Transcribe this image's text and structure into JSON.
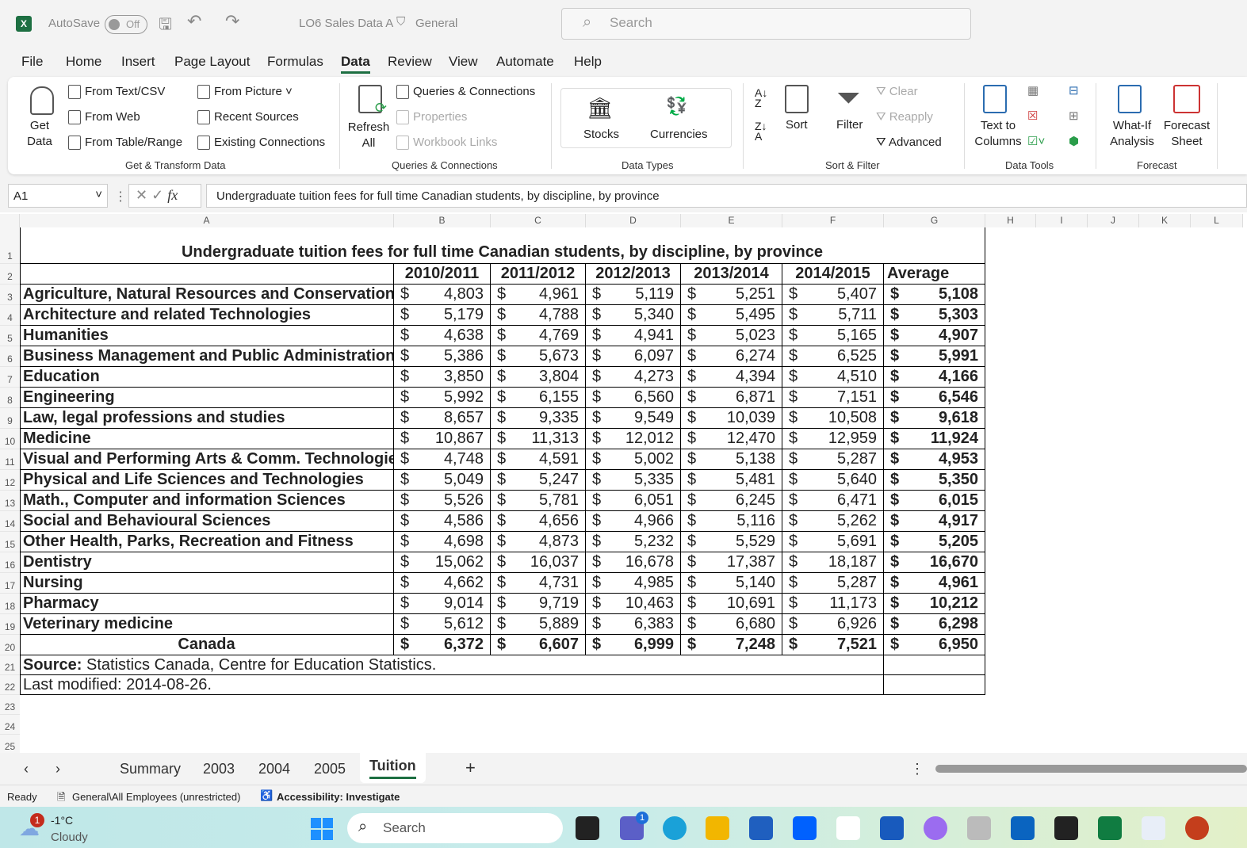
{
  "titlebar": {
    "autosave": "AutoSave",
    "toggle": "Off",
    "filename": "LO6 Sales Data A",
    "label": "General",
    "search": "Search",
    "app_icon": "X"
  },
  "menu": [
    "File",
    "Home",
    "Insert",
    "Page Layout",
    "Formulas",
    "Data",
    "Review",
    "View",
    "Automate",
    "Help"
  ],
  "ribbon": {
    "get_data": "Get Data",
    "get_items": [
      "From Text/CSV",
      "From Web",
      "From Table/Range",
      "From Picture",
      "Recent Sources",
      "Existing Connections"
    ],
    "group1": "Get & Transform Data",
    "refresh": "Refresh All",
    "query_items": [
      "Queries & Connections",
      "Properties",
      "Workbook Links"
    ],
    "group2": "Queries & Connections",
    "stocks": "Stocks",
    "currencies": "Currencies",
    "group3": "Data Types",
    "sort": "Sort",
    "filter": "Filter",
    "clear": "Clear",
    "reapply": "Reapply",
    "advanced": "Advanced",
    "group4": "Sort & Filter",
    "text_to_columns": "Text to Columns",
    "group5": "Data Tools",
    "what_if": "What-If Analysis",
    "forecast_sheet": "Forecast Sheet",
    "group6": "Forecast"
  },
  "formula_bar": {
    "name_box": "A1",
    "fx": "fx",
    "formula": "Undergraduate tuition fees for full time Canadian students, by discipline, by province"
  },
  "columns": [
    "A",
    "B",
    "C",
    "D",
    "E",
    "F",
    "G",
    "H",
    "I",
    "J",
    "K",
    "L"
  ],
  "sheet": {
    "title": "Undergraduate tuition fees for full time Canadian students, by discipline, by province",
    "headers": [
      "2010/2011",
      "2011/2012",
      "2012/2013",
      "2013/2014",
      "2014/2015",
      "Average"
    ],
    "currency": "$",
    "rows": [
      {
        "label": "Agriculture, Natural Resources and Conservation",
        "values": [
          "4,803",
          "4,961",
          "5,119",
          "5,251",
          "5,407",
          "5,108"
        ]
      },
      {
        "label": "Architecture and related Technologies",
        "values": [
          "5,179",
          "4,788",
          "5,340",
          "5,495",
          "5,711",
          "5,303"
        ]
      },
      {
        "label": "Humanities",
        "values": [
          "4,638",
          "4,769",
          "4,941",
          "5,023",
          "5,165",
          "4,907"
        ]
      },
      {
        "label": "Business Management and Public Administration",
        "values": [
          "5,386",
          "5,673",
          "6,097",
          "6,274",
          "6,525",
          "5,991"
        ]
      },
      {
        "label": "Education",
        "values": [
          "3,850",
          "3,804",
          "4,273",
          "4,394",
          "4,510",
          "4,166"
        ]
      },
      {
        "label": "Engineering",
        "values": [
          "5,992",
          "6,155",
          "6,560",
          "6,871",
          "7,151",
          "6,546"
        ]
      },
      {
        "label": "Law, legal professions and studies",
        "values": [
          "8,657",
          "9,335",
          "9,549",
          "10,039",
          "10,508",
          "9,618"
        ]
      },
      {
        "label": "Medicine",
        "values": [
          "10,867",
          "11,313",
          "12,012",
          "12,470",
          "12,959",
          "11,924"
        ]
      },
      {
        "label": "Visual and Performing Arts & Comm. Technologies",
        "values": [
          "4,748",
          "4,591",
          "5,002",
          "5,138",
          "5,287",
          "4,953"
        ]
      },
      {
        "label": "Physical and Life Sciences and Technologies",
        "values": [
          "5,049",
          "5,247",
          "5,335",
          "5,481",
          "5,640",
          "5,350"
        ]
      },
      {
        "label": "Math., Computer and information Sciences",
        "values": [
          "5,526",
          "5,781",
          "6,051",
          "6,245",
          "6,471",
          "6,015"
        ]
      },
      {
        "label": "Social and Behavioural Sciences",
        "values": [
          "4,586",
          "4,656",
          "4,966",
          "5,116",
          "5,262",
          "4,917"
        ]
      },
      {
        "label": "Other Health, Parks, Recreation and Fitness",
        "values": [
          "4,698",
          "4,873",
          "5,232",
          "5,529",
          "5,691",
          "5,205"
        ]
      },
      {
        "label": "Dentistry",
        "values": [
          "15,062",
          "16,037",
          "16,678",
          "17,387",
          "18,187",
          "16,670"
        ]
      },
      {
        "label": "Nursing",
        "values": [
          "4,662",
          "4,731",
          "4,985",
          "5,140",
          "5,287",
          "4,961"
        ]
      },
      {
        "label": "Pharmacy",
        "values": [
          "9,014",
          "9,719",
          "10,463",
          "10,691",
          "11,173",
          "10,212"
        ]
      },
      {
        "label": "Veterinary medicine",
        "values": [
          "5,612",
          "5,889",
          "6,383",
          "6,680",
          "6,926",
          "6,298"
        ]
      }
    ],
    "total": {
      "label": "Canada",
      "values": [
        "6,372",
        "6,607",
        "6,999",
        "7,248",
        "7,521",
        "6,950"
      ]
    },
    "source_label": "Source:",
    "source": " Statistics Canada, Centre for Education Statistics.",
    "modified": "Last modified: 2014-08-26."
  },
  "tabs": [
    "Summary",
    "2003",
    "2004",
    "2005",
    "Tuition"
  ],
  "active_tab": "Tuition",
  "status": {
    "ready": "Ready",
    "label": "General\\All Employees (unrestricted)",
    "accessibility": "Accessibility: Investigate"
  },
  "taskbar": {
    "temp": "-1°C",
    "weather": "Cloudy",
    "badge": "1",
    "search": "Search",
    "teams_badge": "1"
  }
}
